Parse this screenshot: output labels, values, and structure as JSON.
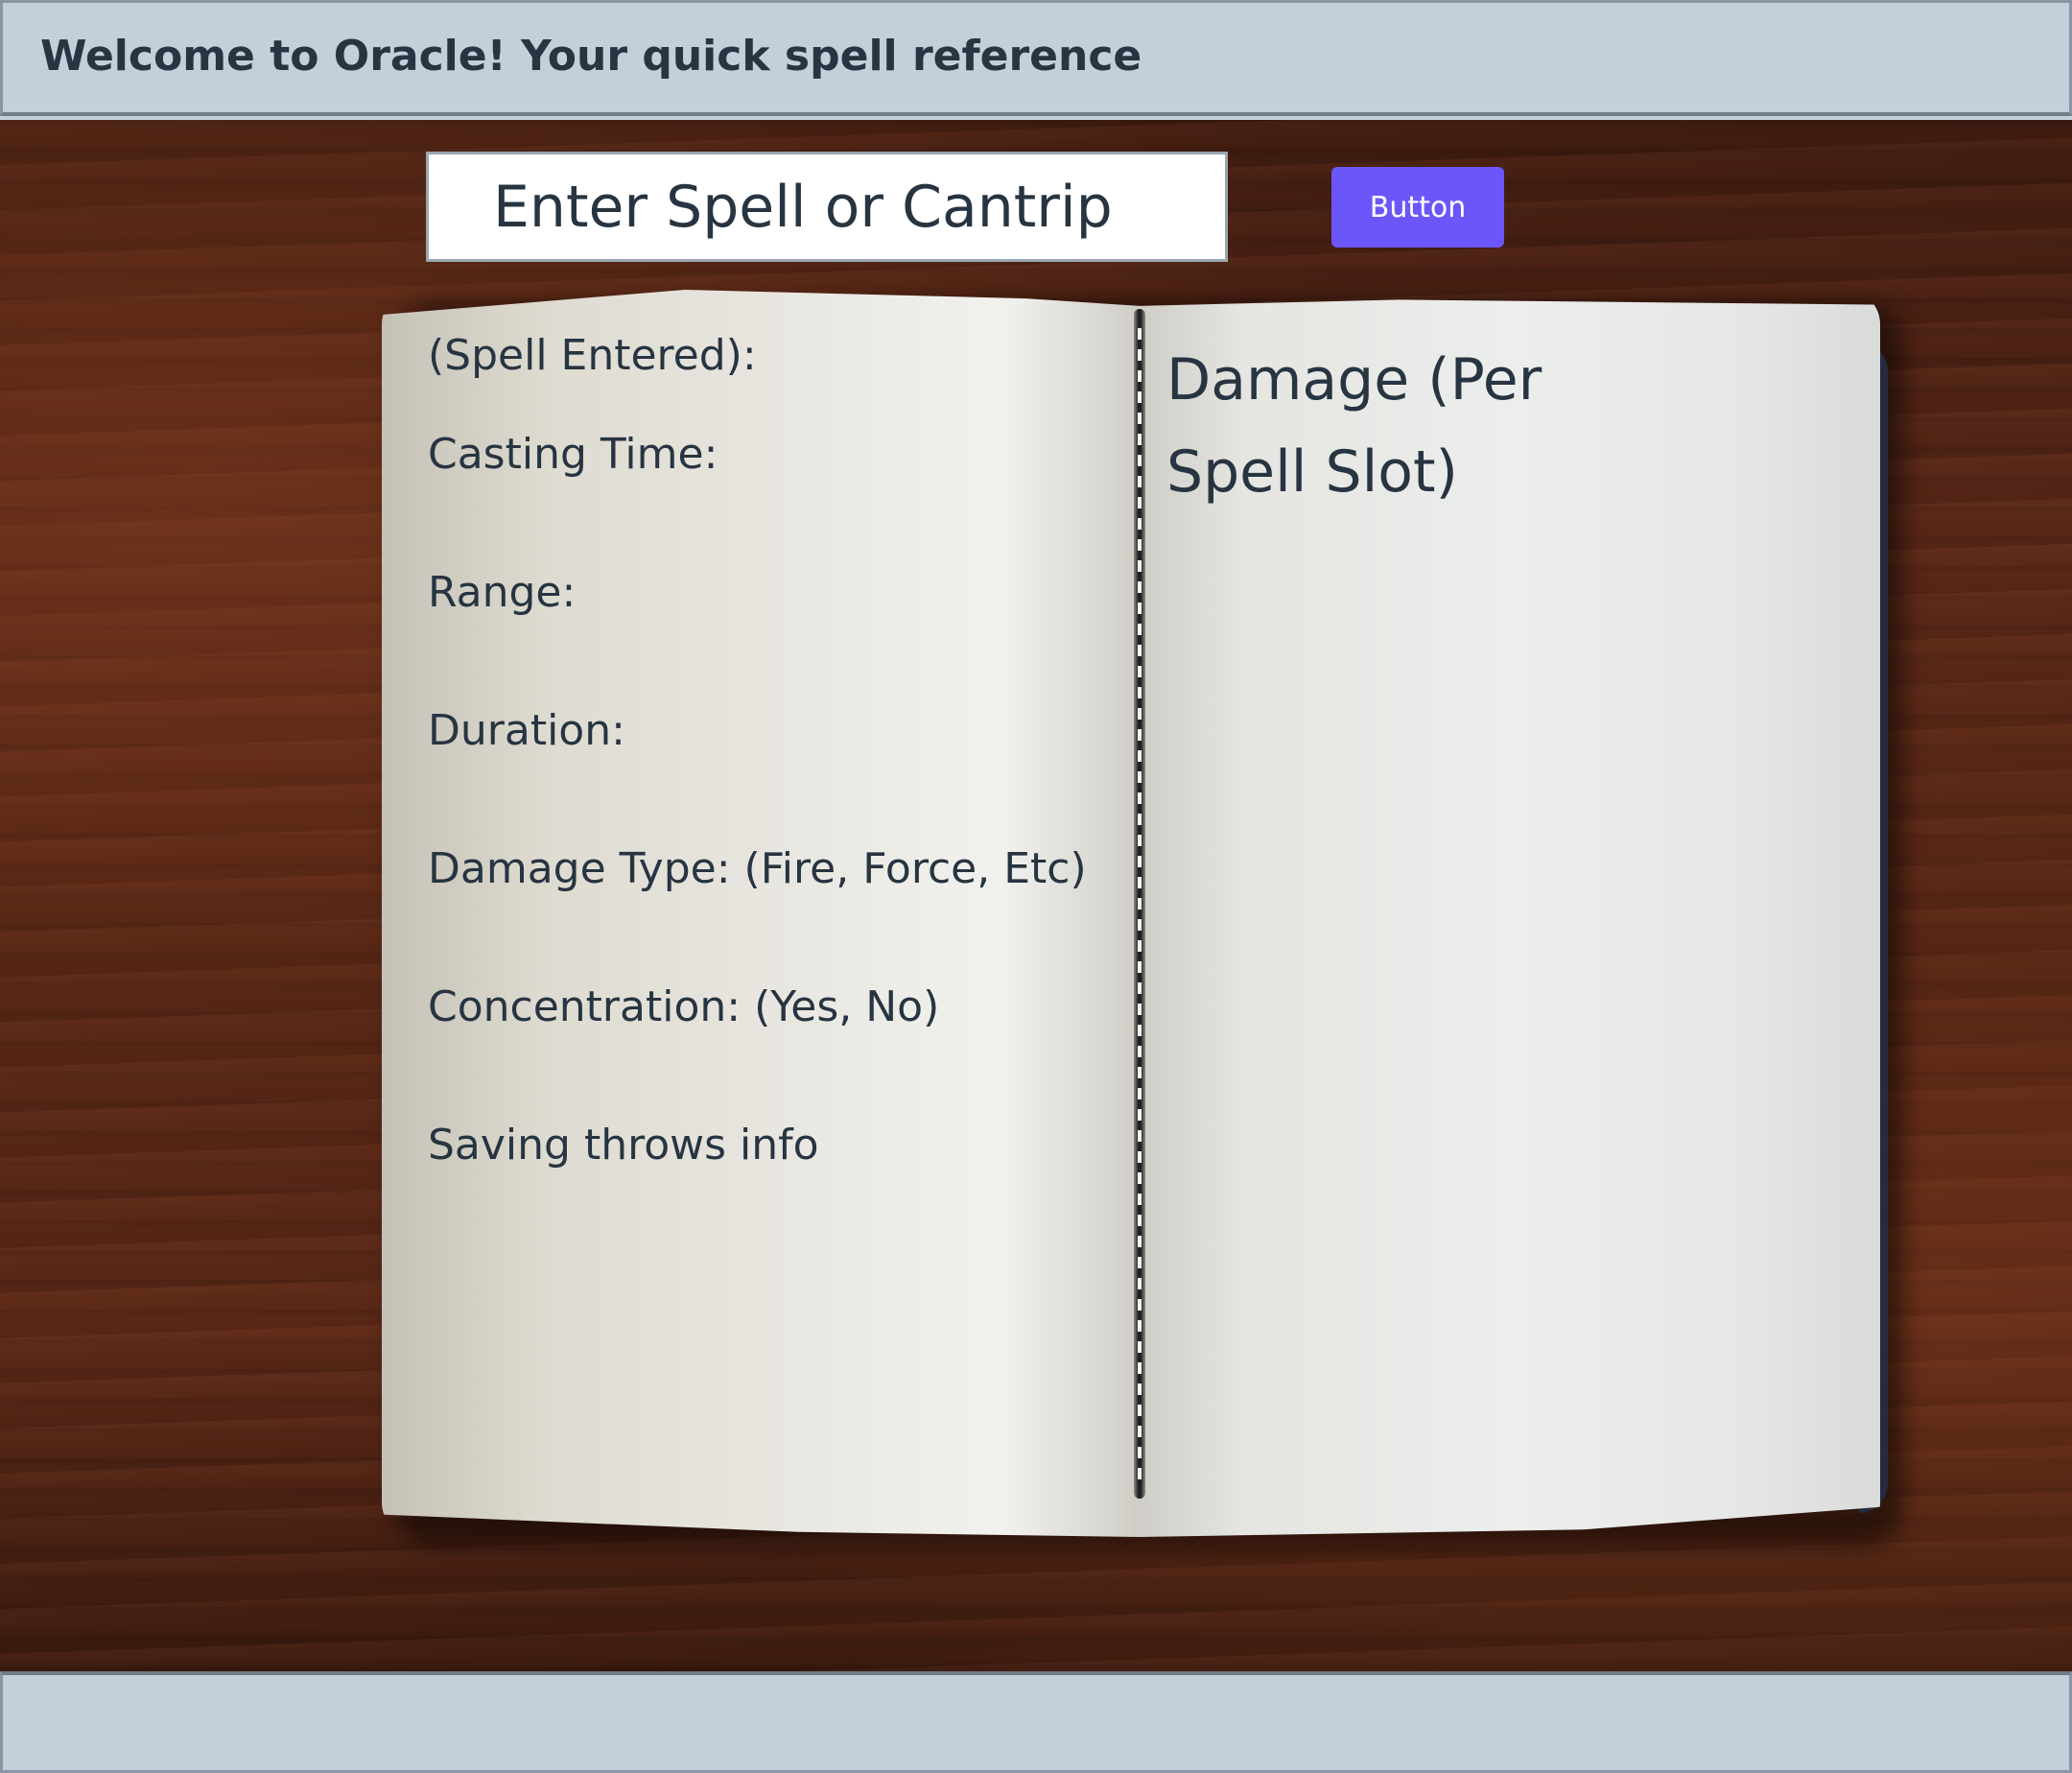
{
  "header": {
    "title": "Welcome to Oracle! Your quick spell reference"
  },
  "search": {
    "placeholder": "Enter Spell or Cantrip",
    "button_label": "Button"
  },
  "spell_card": {
    "fields": [
      "(Spell Entered):",
      "Casting Time:",
      "Range:",
      "Duration:",
      "Damage Type: (Fire, Force, Etc)",
      "Concentration: (Yes, No)",
      "Saving throws info"
    ],
    "damage_heading": "Damage (Per Spell Slot)"
  },
  "colors": {
    "bar_background": "#c3cfd9",
    "text": "#273441",
    "button": "#6b57f9"
  },
  "icons": {
    "background_image": "open-notebook-on-wooden-table"
  }
}
